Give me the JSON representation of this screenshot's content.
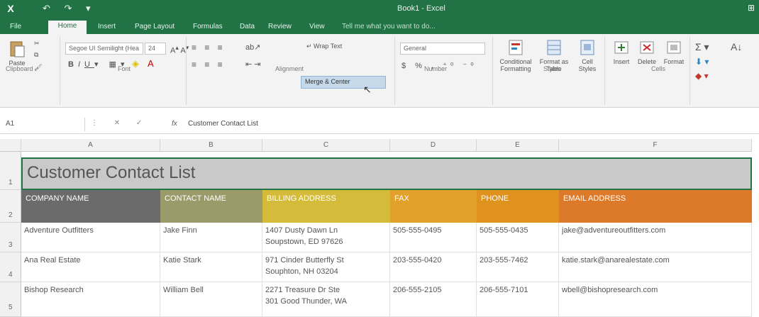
{
  "titlebar": {
    "app_icon": "X",
    "window_title": "Book1 - Excel",
    "window_buttons": "⊞"
  },
  "tabs": [
    {
      "label": "File"
    },
    {
      "label": "Home"
    },
    {
      "label": "Insert"
    },
    {
      "label": "Page Layout"
    },
    {
      "label": "Formulas"
    },
    {
      "label": "Data"
    },
    {
      "label": "Review"
    },
    {
      "label": "View"
    },
    {
      "label": "Tell me what you want to do..."
    }
  ],
  "ribbon": {
    "clipboard": {
      "paste": "Paste",
      "label": "Clipboard"
    },
    "font": {
      "name": "Segoe UI Semilight (Hea",
      "size": "24",
      "label": "Font"
    },
    "alignment": {
      "wrap": "Wrap Text",
      "merge": "Merge & Center",
      "label": "Alignment"
    },
    "number": {
      "format": "General",
      "label": "Number"
    },
    "styles": {
      "conditional": "Conditional Formatting",
      "format_table": "Format as Table",
      "cell_styles": "Cell Styles",
      "label": "Styles"
    },
    "cells": {
      "insert": "Insert",
      "delete": "Delete",
      "format": "Format",
      "label": "Cells"
    }
  },
  "formula_bar": {
    "name_box": "A1",
    "fx": "fx",
    "content": "Customer Contact List"
  },
  "columns": [
    "A",
    "B",
    "C",
    "D",
    "E",
    "F"
  ],
  "rows": [
    "1",
    "2",
    "3",
    "4",
    "5"
  ],
  "sheet": {
    "title": "Customer Contact List",
    "headers": [
      "COMPANY NAME",
      "CONTACT NAME",
      "BILLING ADDRESS",
      "FAX",
      "PHONE",
      "EMAIL ADDRESS"
    ],
    "header_colors": [
      "#6b6b6b",
      "#9a9a6a",
      "#d4bc3a",
      "#e2a12a",
      "#e0921f",
      "#dc7a2a"
    ],
    "data": [
      [
        "Adventure Outfitters",
        "Jake Finn",
        "1407 Dusty Dawn Ln",
        "Soupstown, ED 97626",
        "505-555-0495",
        "505-555-0435",
        "jake@adventureoutfitters.com"
      ],
      [
        "Ana Real Estate",
        "Katie Stark",
        "971 Cinder Butterfly St",
        "Souphton, NH 03204",
        "203-555-0420",
        "203-555-7462",
        "katie.stark@anarealestate.com"
      ],
      [
        "Bishop Research",
        "William Bell",
        "2271 Treasure Dr Ste",
        "301 Good Thunder, WA",
        "206-555-2105",
        "206-555-7101",
        "wbell@bishopresearch.com"
      ]
    ]
  }
}
